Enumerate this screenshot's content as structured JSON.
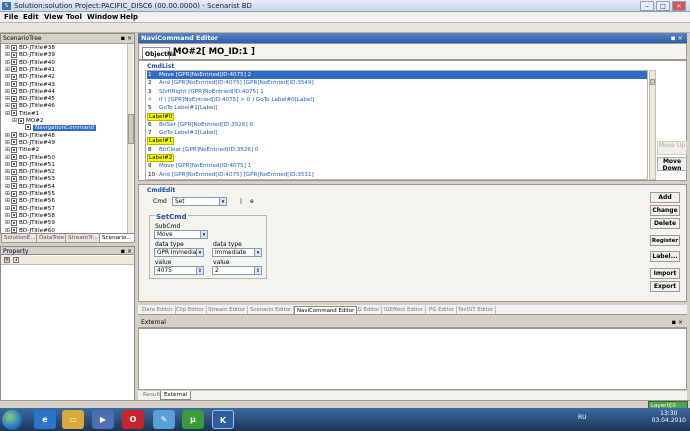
{
  "window": {
    "title": "Solution:solution  Project:PACIFIC_DISC6 (00.00.0000) - Scenarist BD",
    "app_icon": "S",
    "min_label": "‒",
    "max_label": "□",
    "close_label": "✕"
  },
  "menu": [
    "File",
    "Edit",
    "View",
    "Tool",
    "Window",
    "Help"
  ],
  "scenario_tree": {
    "header": "ScenarioTree",
    "pin": "◾ ×",
    "items": [
      {
        "label": "BD-JTitle#38",
        "indent": 1
      },
      {
        "label": "BD-JTitle#39",
        "indent": 1
      },
      {
        "label": "BD-JTitle#40",
        "indent": 1
      },
      {
        "label": "BD-JTitle#41",
        "indent": 1
      },
      {
        "label": "BD-JTitle#42",
        "indent": 1
      },
      {
        "label": "BD-JTitle#43",
        "indent": 1
      },
      {
        "label": "BD-JTitle#44",
        "indent": 1
      },
      {
        "label": "BD-JTitle#45",
        "indent": 1
      },
      {
        "label": "BD-JTitle#46",
        "indent": 1
      },
      {
        "label": "Title#1",
        "indent": 1
      },
      {
        "label": "MO#2",
        "indent": 2
      },
      {
        "label": "NavigationCommand",
        "indent": 3,
        "selected": true
      },
      {
        "label": "BD-JTitle#48",
        "indent": 1
      },
      {
        "label": "BD-JTitle#49",
        "indent": 1
      },
      {
        "label": "Title#2",
        "indent": 1
      },
      {
        "label": "BD-JTitle#50",
        "indent": 1
      },
      {
        "label": "BD-JTitle#51",
        "indent": 1
      },
      {
        "label": "BD-JTitle#52",
        "indent": 1
      },
      {
        "label": "BD-JTitle#53",
        "indent": 1
      },
      {
        "label": "BD-JTitle#54",
        "indent": 1
      },
      {
        "label": "BD-JTitle#55",
        "indent": 1
      },
      {
        "label": "BD-JTitle#56",
        "indent": 1
      },
      {
        "label": "BD-JTitle#57",
        "indent": 1
      },
      {
        "label": "BD-JTitle#58",
        "indent": 1
      },
      {
        "label": "BD-JTitle#59",
        "indent": 1
      },
      {
        "label": "BD-JTitle#60",
        "indent": 1
      }
    ],
    "tabs": [
      "SolutionE...",
      "DataTree",
      "StreamTr...",
      "Scenario..."
    ]
  },
  "property_panel": {
    "header": "Property"
  },
  "editor": {
    "header": "NaviCommand Editor",
    "pin": "◾ ×",
    "object_tab": "ObjectNa",
    "object_name": "MO#2[ MO_ID:1 ]",
    "cmdlist_label": "CmdList",
    "lines": [
      {
        "n": "1",
        "text": "Move  [GPR]NoEntried[ID:4075]   2",
        "kind": "sel"
      },
      {
        "n": "2",
        "text": "And  [GPR]NoEntried[ID:4075]     [GPR]NoEntried[ID:3549]",
        "kind": "normal"
      },
      {
        "n": "3",
        "text": "ShiftRight  [GPR]NoEntried[ID:4075]   1",
        "kind": "normal"
      },
      {
        "n": "4",
        "text": "if ( [GPR]NoEntried[ID:4075]  >  0 )    GoTo  Label#0[Label]",
        "kind": "dim"
      },
      {
        "n": "5",
        "text": "GoTo  Label#1[Label]",
        "kind": "normal"
      },
      {
        "n": "",
        "text": "Label#0",
        "kind": "label"
      },
      {
        "n": "6",
        "text": "BitSet  [GPR]NoEntried[ID:3526]   0",
        "kind": "normal"
      },
      {
        "n": "7",
        "text": "GoTo  Label#2[Label]",
        "kind": "normal"
      },
      {
        "n": "",
        "text": "Label#1",
        "kind": "label"
      },
      {
        "n": "8",
        "text": "BitClear  [GPR]NoEntried[ID:3526]   0",
        "kind": "normal"
      },
      {
        "n": "",
        "text": "Label#2",
        "kind": "label"
      },
      {
        "n": "9",
        "text": "Move  [GPR]NoEntried[ID:4075]   1",
        "kind": "normal"
      },
      {
        "n": "10",
        "text": "And  [GPR]NoEntried[ID:4075]     [GPR]NoEntried[ID:3531]",
        "kind": "normal"
      }
    ],
    "move_up_label": "Move Up",
    "move_down_label": "Move Down"
  },
  "cmdedit": {
    "label": "CmdEdit",
    "cmd_label": "Cmd",
    "cmd_value": "Set",
    "sep1": "|",
    "sep2": "e",
    "setcmd_label": "SetCmd",
    "subcmd_label": "SubCmd",
    "subcmd_value": "Move",
    "dt1_label": "data type",
    "dt1_value": "GPR Immediat",
    "dt2_label": "data type",
    "dt2_value": "Immediate",
    "v1_label": "value",
    "v1_value": "4075",
    "v2_label": "value",
    "v2_value": "2",
    "buttons": [
      "Add",
      "Change",
      "Delete",
      "Register",
      "Label...",
      "Import",
      "Export"
    ]
  },
  "editor_tabs": [
    "Data Editor",
    "Clip Editor",
    "Stream Editor",
    "Scenario Editor",
    "NaviCommand Editor",
    "IG Editor",
    "IGEffect Editor",
    "PG Editor",
    "TextST Editor"
  ],
  "external": {
    "header": "External",
    "pin": "◾ ×",
    "tabs": [
      "Result",
      "External"
    ]
  },
  "status": {
    "layer": "Layer0[0"
  },
  "taskbar": {
    "icons": [
      "ie-icon",
      "folder-icon",
      "media-icon",
      "opera-icon",
      "paint-icon",
      "utorrent-icon",
      "scenarist-icon"
    ],
    "lang": "RU",
    "time": "13:30",
    "date": "03.04.2010"
  }
}
